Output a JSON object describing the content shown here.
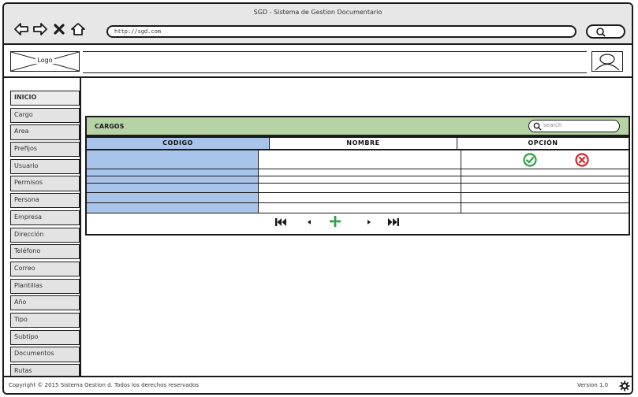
{
  "window": {
    "title": "SGD - Sistema de Gestion Documentario"
  },
  "browser": {
    "url": "http://sgd.com",
    "icons": [
      "back-arrow-icon",
      "forward-arrow-icon",
      "close-icon",
      "home-icon",
      "search-icon"
    ]
  },
  "header": {
    "logo_label": "Logo",
    "user_icon": "user-icon"
  },
  "sidebar": {
    "items": [
      {
        "label": "INICIO"
      },
      {
        "label": "Cargo"
      },
      {
        "label": "Area"
      },
      {
        "label": "Prefijos"
      },
      {
        "label": "Usuario"
      },
      {
        "label": "Permisos"
      },
      {
        "label": "Persona"
      },
      {
        "label": "Empresa"
      },
      {
        "label": "Dirección"
      },
      {
        "label": "Teléfono"
      },
      {
        "label": "Correo"
      },
      {
        "label": "Plantillas"
      },
      {
        "label": "Año"
      },
      {
        "label": "Tipo"
      },
      {
        "label": "Subtipo"
      },
      {
        "label": "Documentos"
      },
      {
        "label": "Rutas"
      }
    ]
  },
  "panel": {
    "title": "CARGOS",
    "search_placeholder": "search"
  },
  "table": {
    "columns": [
      "CODIGO",
      "NOMBRE",
      "OPCIÓN"
    ],
    "rows": [
      {
        "codigo": "",
        "nombre": "",
        "opcion": ""
      },
      {
        "codigo": "",
        "nombre": "",
        "opcion": ""
      },
      {
        "codigo": "",
        "nombre": "",
        "opcion": ""
      },
      {
        "codigo": "",
        "nombre": "",
        "opcion": ""
      },
      {
        "codigo": "",
        "nombre": "",
        "opcion": ""
      },
      {
        "codigo": "",
        "nombre": "",
        "opcion": ""
      }
    ],
    "row_actions": [
      "check-circle-icon",
      "close-circle-icon"
    ],
    "colors": {
      "selected": "#a9c4ea",
      "header": "#b5d3a4",
      "ok": "#2ea043",
      "cancel": "#d62424"
    }
  },
  "pager": {
    "icons": [
      "first-page-icon",
      "prev-page-icon",
      "add-icon",
      "next-page-icon",
      "last-page-icon"
    ]
  },
  "footer": {
    "copyright": "Copyright © 2015 Sistema Gestion d. Todos los derechos reservados",
    "version": "Version 1.0",
    "settings_icon": "gear-icon"
  }
}
